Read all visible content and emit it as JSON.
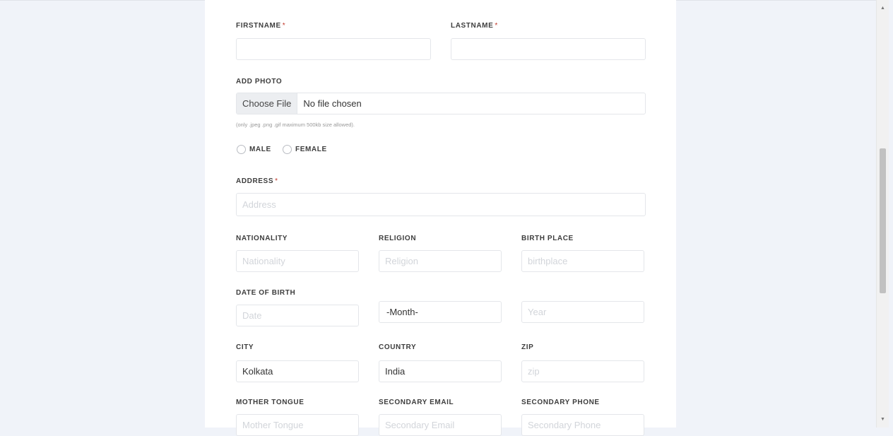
{
  "form": {
    "firstname": {
      "label": "FIRSTNAME",
      "required": "*",
      "value": "",
      "placeholder": ""
    },
    "lastname": {
      "label": "LASTNAME",
      "required": "*",
      "value": "",
      "placeholder": ""
    },
    "photo": {
      "label": "ADD PHOTO",
      "button": "Choose File",
      "status": "No file chosen",
      "note": "(only .jpeg .png .gif maximum 500kb size allowed)."
    },
    "gender": {
      "male": "MALE",
      "female": "FEMALE"
    },
    "address": {
      "label": "ADDRESS",
      "required": "*",
      "placeholder": "Address"
    },
    "nationality": {
      "label": "NATIONALITY",
      "placeholder": "Nationality"
    },
    "religion": {
      "label": "RELIGION",
      "placeholder": "Religion"
    },
    "birthplace": {
      "label": "BIRTH PLACE",
      "placeholder": "birthplace"
    },
    "dob": {
      "label": "DATE OF BIRTH",
      "date_placeholder": "Date",
      "month_selected": "-Month-",
      "year_placeholder": "Year"
    },
    "city": {
      "label": "CITY",
      "value": "Kolkata"
    },
    "country": {
      "label": "COUNTRY",
      "value": "India"
    },
    "zip": {
      "label": "ZIP",
      "placeholder": "zip"
    },
    "mother_tongue": {
      "label": "MOTHER TONGUE",
      "placeholder": "Mother Tongue"
    },
    "secondary_email": {
      "label": "SECONDARY EMAIL",
      "placeholder": "Secondary Email"
    },
    "secondary_phone": {
      "label": "SECONDARY PHONE",
      "placeholder": "Secondary Phone"
    }
  },
  "colors": {
    "page_bg": "#f0f3f9",
    "card_bg": "#ffffff",
    "required": "#c0392b"
  },
  "icons": {
    "scroll_up": "scroll-up-arrow-icon",
    "scroll_down": "scroll-down-arrow-icon"
  }
}
